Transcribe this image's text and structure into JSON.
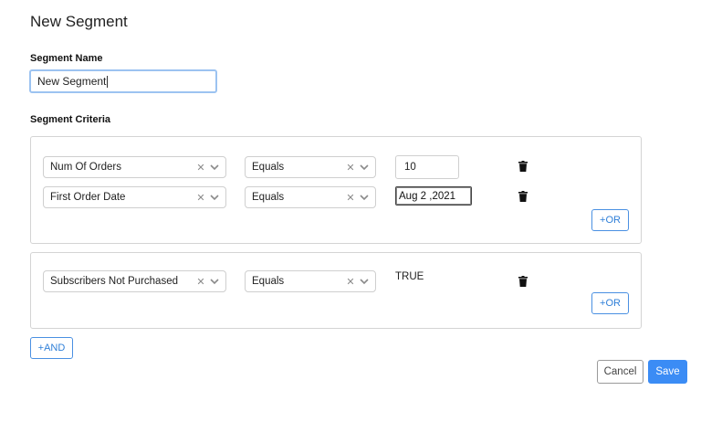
{
  "page": {
    "title": "New Segment"
  },
  "segment_name": {
    "label": "Segment Name",
    "value": "New Segment"
  },
  "criteria": {
    "label": "Segment Criteria",
    "groups": [
      {
        "rows": [
          {
            "field": "Num Of Orders",
            "operator": "Equals",
            "value": "10"
          },
          {
            "field": "First Order Date",
            "operator": "Equals",
            "value": "Aug 2 ,2021"
          }
        ],
        "or_label": "+OR"
      },
      {
        "rows": [
          {
            "field": "Subscribers Not Purchased",
            "operator": "Equals",
            "value": "TRUE"
          }
        ],
        "or_label": "+OR"
      }
    ],
    "and_label": "+AND"
  },
  "actions": {
    "cancel_label": "Cancel",
    "save_label": "Save"
  },
  "icons": {
    "clear": "close-icon",
    "dropdown": "chevron-down-icon",
    "delete": "trash-icon"
  },
  "colors": {
    "accent": "#3b8cf5",
    "focus_border": "#9cc3f1",
    "border": "#d4d4d4"
  }
}
